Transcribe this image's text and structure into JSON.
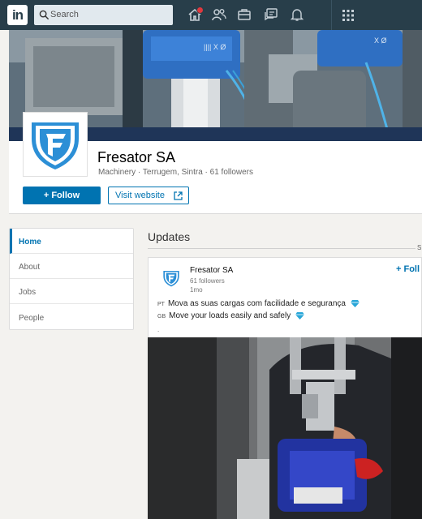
{
  "nav": {
    "logo": "in",
    "search_placeholder": "Search",
    "icons": [
      "home-icon",
      "people-icon",
      "jobs-icon",
      "messaging-icon",
      "notifications-icon",
      "apps-grid-icon"
    ]
  },
  "company": {
    "name": "Fresator SA",
    "meta": "Machinery · Terrugem, Sintra · 61 followers",
    "follow_label": "+ Follow",
    "website_label": "Visit website"
  },
  "sidebar": {
    "items": [
      {
        "label": "Home",
        "active": true
      },
      {
        "label": "About",
        "active": false
      },
      {
        "label": "Jobs",
        "active": false
      },
      {
        "label": "People",
        "active": false
      }
    ]
  },
  "updates": {
    "title": "Updates",
    "side_mark": "S",
    "post": {
      "author": "Fresator SA",
      "followers": "61 followers",
      "time": "1mo",
      "follow_label": "+ Foll",
      "lines": [
        {
          "lang": "PT",
          "text": "Mova as suas cargas com facilidade e segurança"
        },
        {
          "lang": "GB",
          "text": "Move your loads easily and safely"
        }
      ],
      "more_mark": "."
    }
  },
  "colors": {
    "nav_bg": "#283e4a",
    "accent": "#0073b1",
    "page_bg": "#f3f2ef",
    "gem": "#29a6d8",
    "notification_badge": "#e0383e"
  }
}
